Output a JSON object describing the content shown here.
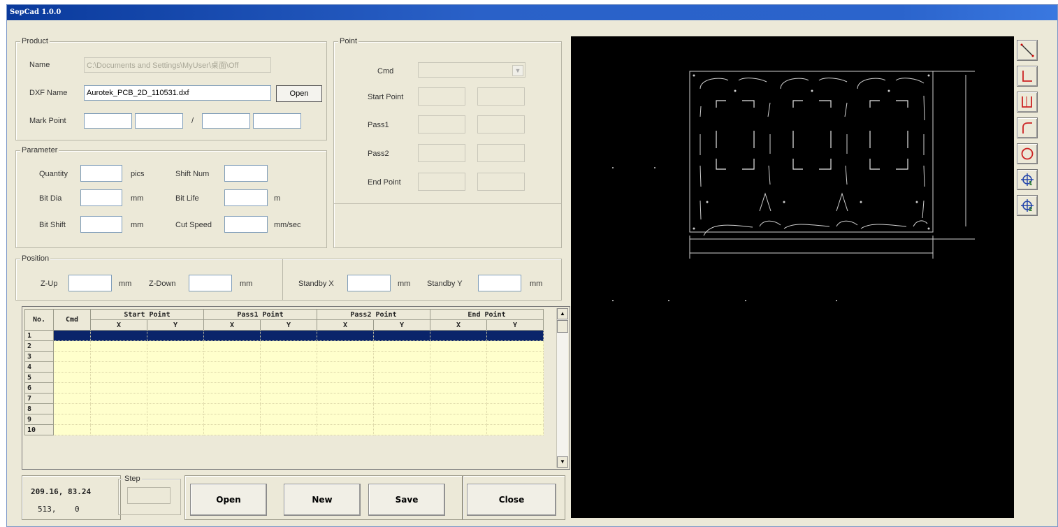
{
  "window": {
    "title": "SepCad 1.0.0"
  },
  "product": {
    "group_label": "Product",
    "name_label": "Name",
    "name_value": "C:\\Documents and Settings\\MyUser\\桌面\\Off",
    "dxf_label": "DXF Name",
    "dxf_value": "Aurotek_PCB_2D_110531.dxf",
    "open_label": "Open",
    "mark_label": "Mark Point",
    "mark_sep": "/"
  },
  "point": {
    "group_label": "Point",
    "cmd_label": "Cmd",
    "start_label": "Start Point",
    "pass1_label": "Pass1",
    "pass2_label": "Pass2",
    "end_label": "End Point"
  },
  "parameter": {
    "group_label": "Parameter",
    "quantity_label": "Quantity",
    "quantity_unit": "pics",
    "shiftnum_label": "Shift Num",
    "bitdia_label": "Bit Dia",
    "bitdia_unit": "mm",
    "bitlife_label": "Bit Life",
    "bitlife_unit": "m",
    "bitshift_label": "Bit Shift",
    "bitshift_unit": "mm",
    "cutspeed_label": "Cut Speed",
    "cutspeed_unit": "mm/sec"
  },
  "position": {
    "group_label": "Position",
    "zup_label": "Z-Up",
    "zup_unit": "mm",
    "zdown_label": "Z-Down",
    "zdown_unit": "mm",
    "standbyx_label": "Standby X",
    "standbyx_unit": "mm",
    "standbyy_label": "Standby Y",
    "standbyy_unit": "mm"
  },
  "grid": {
    "no_header": "No.",
    "cmd_header": "Cmd",
    "start_header": "Start Point",
    "pass1_header": "Pass1 Point",
    "pass2_header": "Pass2 Point",
    "end_header": "End Point",
    "x_header": "X",
    "y_header": "Y",
    "rows": [
      "1",
      "2",
      "3",
      "4",
      "5",
      "6",
      "7",
      "8",
      "9",
      "10"
    ],
    "selected_row": "1"
  },
  "status": {
    "coord_line1": "209.16, 83.24",
    "coord_line2": "513,    0",
    "step_label": "Step"
  },
  "actions": {
    "open_label": "Open",
    "new_label": "New",
    "save_label": "Save",
    "close_label": "Close"
  },
  "toolbar": {
    "tools": [
      "line-tool-icon",
      "corner-line-tool-icon",
      "u-line-tool-icon",
      "arc-tool-icon",
      "circle-tool-icon",
      "mark-point-1-icon",
      "mark-point-2-icon"
    ]
  },
  "colors": {
    "title_bar": "#2a61c8",
    "canvas_bg": "#000000",
    "grid_row_bg": "#ffffcc",
    "selected_row": "#0a246a",
    "window_bg": "#ece9d8"
  }
}
